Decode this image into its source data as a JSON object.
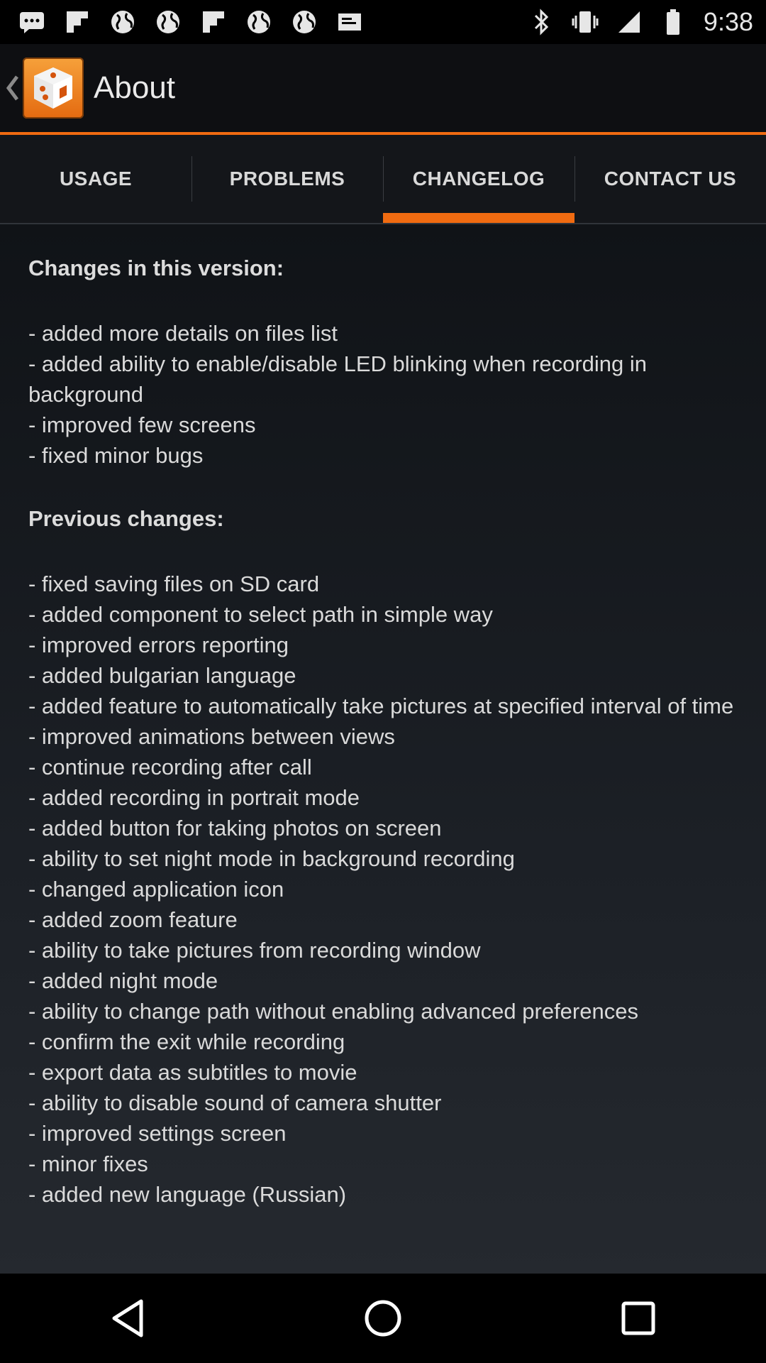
{
  "status_bar": {
    "time": "9:38",
    "left_icons": [
      "message-icon",
      "flipboard-icon",
      "globe-icon",
      "globe-icon",
      "flipboard-icon",
      "globe-icon",
      "globe-icon",
      "mail-icon"
    ],
    "right_icons": [
      "bluetooth-icon",
      "vibrate-icon",
      "signal-icon",
      "battery-icon"
    ]
  },
  "action_bar": {
    "title": "About",
    "accent_color": "#f06b11"
  },
  "tabs": [
    {
      "label": "USAGE",
      "active": false
    },
    {
      "label": "PROBLEMS",
      "active": false
    },
    {
      "label": "CHANGELOG",
      "active": true
    },
    {
      "label": "CONTACT US",
      "active": false
    }
  ],
  "changelog": {
    "current_title": "Changes in this version:",
    "current_items": [
      "- added more details on files list",
      "- added ability to enable/disable LED blinking when recording in background",
      "- improved few screens",
      "- fixed minor bugs"
    ],
    "previous_title": "Previous changes:",
    "previous_items": [
      "- fixed saving files on SD card",
      "- added component to select path in simple way",
      "- improved errors reporting",
      "- added bulgarian language",
      "- added feature to automatically take pictures at specified interval of time",
      "- improved animations between views",
      "- continue recording after call",
      "- added recording in portrait mode",
      "- added button for taking photos on screen",
      "- ability to set night mode in background recording",
      "- changed application icon",
      "- added zoom feature",
      "- ability to take pictures from recording window",
      "- added night mode",
      "- ability to change path without enabling advanced preferences",
      "- confirm the exit while recording",
      "- export data as subtitles to movie",
      "- ability to disable sound of camera shutter",
      "- improved settings screen",
      "- minor fixes",
      "- added new language (Russian)"
    ]
  },
  "nav_bar": [
    "back-icon",
    "home-icon",
    "recents-icon"
  ]
}
